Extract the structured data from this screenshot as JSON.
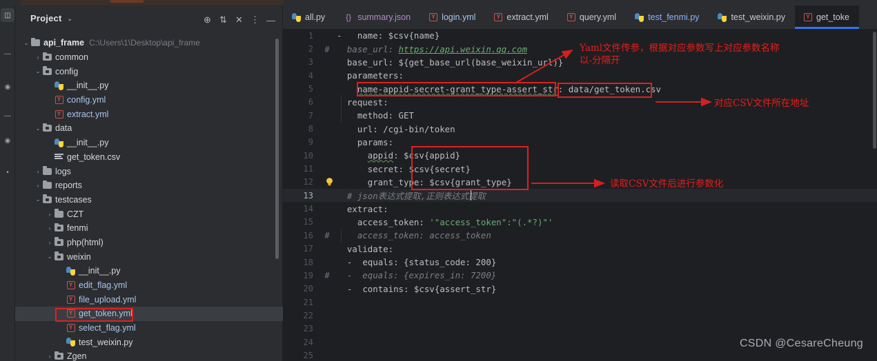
{
  "window": {
    "rail_icons": [
      "project-rail-icon",
      "structure-rail-icon",
      "bookmarks-rail-icon",
      "favorites-rail-icon"
    ]
  },
  "project_panel": {
    "title": "Project",
    "caret": "⌄",
    "tools": [
      {
        "name": "locate-icon",
        "glyph": "⊕"
      },
      {
        "name": "expand-collapse-icon",
        "glyph": "⇅"
      },
      {
        "name": "collapse-all-icon",
        "glyph": "✕"
      },
      {
        "name": "more-options-icon",
        "glyph": "⋮"
      },
      {
        "name": "hide-panel-icon",
        "glyph": "—"
      }
    ],
    "tree": [
      {
        "indent": 0,
        "arrow": "⌄",
        "icon": "folder",
        "label": "api_frame",
        "bold": true,
        "path": "C:\\Users\\1\\Desktop\\api_frame",
        "selected": false
      },
      {
        "indent": 1,
        "arrow": "›",
        "icon": "folder-module",
        "label": "common",
        "bold": false,
        "path": "",
        "selected": false
      },
      {
        "indent": 1,
        "arrow": "⌄",
        "icon": "folder-module",
        "label": "config",
        "bold": false,
        "path": "",
        "selected": false
      },
      {
        "indent": 2,
        "arrow": "",
        "icon": "python",
        "label": "__init__.py",
        "bold": false,
        "path": "",
        "selected": false
      },
      {
        "indent": 2,
        "arrow": "",
        "icon": "yml",
        "label": "config.yml",
        "bold": false,
        "path": "",
        "selected": false,
        "kind": "yml"
      },
      {
        "indent": 2,
        "arrow": "",
        "icon": "yml",
        "label": "extract.yml",
        "bold": false,
        "path": "",
        "selected": false,
        "kind": "yml"
      },
      {
        "indent": 1,
        "arrow": "⌄",
        "icon": "folder-module",
        "label": "data",
        "bold": false,
        "path": "",
        "selected": false
      },
      {
        "indent": 2,
        "arrow": "",
        "icon": "python",
        "label": "__init__.py",
        "bold": false,
        "path": "",
        "selected": false
      },
      {
        "indent": 2,
        "arrow": "",
        "icon": "csv",
        "label": "get_token.csv",
        "bold": false,
        "path": "",
        "selected": false
      },
      {
        "indent": 1,
        "arrow": "›",
        "icon": "folder",
        "label": "logs",
        "bold": false,
        "path": "",
        "selected": false
      },
      {
        "indent": 1,
        "arrow": "›",
        "icon": "folder",
        "label": "reports",
        "bold": false,
        "path": "",
        "selected": false
      },
      {
        "indent": 1,
        "arrow": "⌄",
        "icon": "folder-module",
        "label": "testcases",
        "bold": false,
        "path": "",
        "selected": false
      },
      {
        "indent": 2,
        "arrow": "›",
        "icon": "folder",
        "label": "CZT",
        "bold": false,
        "path": "",
        "selected": false
      },
      {
        "indent": 2,
        "arrow": "›",
        "icon": "folder-module",
        "label": "fenmi",
        "bold": false,
        "path": "",
        "selected": false
      },
      {
        "indent": 2,
        "arrow": "›",
        "icon": "folder-module",
        "label": "php(html)",
        "bold": false,
        "path": "",
        "selected": false
      },
      {
        "indent": 2,
        "arrow": "⌄",
        "icon": "folder-module",
        "label": "weixin",
        "bold": false,
        "path": "",
        "selected": false
      },
      {
        "indent": 3,
        "arrow": "",
        "icon": "python",
        "label": "__init__.py",
        "bold": false,
        "path": "",
        "selected": false
      },
      {
        "indent": 3,
        "arrow": "",
        "icon": "yml",
        "label": "edit_flag.yml",
        "bold": false,
        "path": "",
        "selected": false
      },
      {
        "indent": 3,
        "arrow": "",
        "icon": "yml",
        "label": "file_upload.yml",
        "bold": false,
        "path": "",
        "selected": false
      },
      {
        "indent": 3,
        "arrow": "",
        "icon": "yml",
        "label": "get_token.yml",
        "bold": false,
        "path": "",
        "selected": true
      },
      {
        "indent": 3,
        "arrow": "",
        "icon": "yml",
        "label": "select_flag.yml",
        "bold": false,
        "path": "",
        "selected": false
      },
      {
        "indent": 3,
        "arrow": "",
        "icon": "python",
        "label": "test_weixin.py",
        "bold": false,
        "path": "",
        "selected": false
      },
      {
        "indent": 2,
        "arrow": "›",
        "icon": "folder-module",
        "label": "Zgen",
        "bold": false,
        "path": "",
        "selected": false
      }
    ]
  },
  "editor": {
    "tabs": [
      {
        "label": "all.py",
        "icon": "python",
        "kind": "py",
        "active": false
      },
      {
        "label": "summary.json",
        "icon": "json",
        "kind": "json",
        "active": false
      },
      {
        "label": "login.yml",
        "icon": "yml",
        "kind": "yml",
        "active": false
      },
      {
        "label": "extract.yml",
        "icon": "yml",
        "kind": "ymlw",
        "active": false
      },
      {
        "label": "query.yml",
        "icon": "yml",
        "kind": "ymlw",
        "active": false
      },
      {
        "label": "test_fenmi.py",
        "icon": "python",
        "kind": "pyb",
        "active": false
      },
      {
        "label": "test_weixin.py",
        "icon": "python",
        "kind": "py",
        "active": false
      },
      {
        "label": "get_toke",
        "icon": "yml",
        "kind": "ymlw",
        "active": true
      }
    ],
    "lines": [
      {
        "n": "1",
        "hash": "",
        "bulb": false,
        "current": false,
        "html": "<span class=\"k-dash\">-   </span><span class=\"k-key\">name</span>: $csv{name}"
      },
      {
        "n": "2",
        "hash": "#",
        "bulb": false,
        "current": false,
        "html": "<span class=\"k-com\">  base_url: </span><span class=\"k-url\">https://api.weixin.qq.com</span>"
      },
      {
        "n": "3",
        "hash": "",
        "bulb": false,
        "current": false,
        "html": "  <span class=\"k-key\">base_url</span>: ${get_base_url(base_weixin_url)}"
      },
      {
        "n": "4",
        "hash": "",
        "bulb": false,
        "current": false,
        "html": "  <span class=\"k-key\">parameters</span>:"
      },
      {
        "n": "5",
        "hash": "",
        "bulb": false,
        "current": false,
        "html": "    <span class=\"k-key sq\">name-appid-secret-grant_type-assert_str</span>: data/get_token.csv"
      },
      {
        "n": "6",
        "hash": "",
        "bulb": false,
        "current": false,
        "html": "  <span class=\"k-key\">request</span>:"
      },
      {
        "n": "7",
        "hash": "",
        "bulb": false,
        "current": false,
        "html": "    <span class=\"k-key\">method</span>: GET"
      },
      {
        "n": "8",
        "hash": "",
        "bulb": false,
        "current": false,
        "html": "    <span class=\"k-key\">url</span>: /cgi-bin/token"
      },
      {
        "n": "9",
        "hash": "",
        "bulb": false,
        "current": false,
        "html": "    <span class=\"k-key\">params</span>:"
      },
      {
        "n": "10",
        "hash": "",
        "bulb": false,
        "current": false,
        "html": "      <span class=\"k-key sq\">appid</span>: $csv{appid}"
      },
      {
        "n": "11",
        "hash": "",
        "bulb": false,
        "current": false,
        "html": "      <span class=\"k-key\">secret</span>: $csv{secret}"
      },
      {
        "n": "12",
        "hash": "",
        "bulb": true,
        "current": false,
        "html": "      <span class=\"k-key\">grant_type</span>: $csv{grant_type}"
      },
      {
        "n": "13",
        "hash": "",
        "bulb": false,
        "current": true,
        "html": "<span class=\"k-com\">  # json表达式提取,正则表达式提取</span>"
      },
      {
        "n": "14",
        "hash": "",
        "bulb": false,
        "current": false,
        "html": "  <span class=\"k-key\">extract</span>:"
      },
      {
        "n": "15",
        "hash": "",
        "bulb": false,
        "current": false,
        "html": "    <span class=\"k-key\">access_token</span>: <span class=\"k-str\">'\"access_token\":\"(.*?)\"'</span>"
      },
      {
        "n": "16",
        "hash": "#",
        "bulb": false,
        "current": false,
        "html": "<span class=\"k-com\">    access_token: access_token</span>"
      },
      {
        "n": "17",
        "hash": "",
        "bulb": false,
        "current": false,
        "html": "  <span class=\"k-key\">validate</span>:"
      },
      {
        "n": "18",
        "hash": "",
        "bulb": false,
        "current": false,
        "html": "  <span class=\"k-dash\">-</span>  <span class=\"k-key\">equals</span>: {status_code: 200}"
      },
      {
        "n": "19",
        "hash": "#",
        "bulb": false,
        "current": false,
        "html": "<span class=\"k-com\">  -  equals: {expires_in: 7200}</span>"
      },
      {
        "n": "20",
        "hash": "",
        "bulb": false,
        "current": false,
        "html": "  <span class=\"k-dash\">-</span>  <span class=\"k-key\">contains</span>: $csv{assert_str}"
      },
      {
        "n": "21",
        "hash": "",
        "bulb": false,
        "current": false,
        "html": ""
      },
      {
        "n": "22",
        "hash": "",
        "bulb": false,
        "current": false,
        "html": ""
      },
      {
        "n": "23",
        "hash": "",
        "bulb": false,
        "current": false,
        "html": ""
      },
      {
        "n": "24",
        "hash": "",
        "bulb": false,
        "current": false,
        "html": ""
      },
      {
        "n": "25",
        "hash": "",
        "bulb": false,
        "current": false,
        "html": ""
      }
    ]
  },
  "annotations": [
    {
      "name": "annotation-yaml-params",
      "text": "Yaml文件传参，根据对应参数写上对应参数名称\n以-分隔开"
    },
    {
      "name": "annotation-csv-path",
      "text": "对应CSV文件所在地址"
    },
    {
      "name": "annotation-csv-parameterize",
      "text": "读取CSV文件后进行参数化"
    }
  ],
  "watermark": "CSDN @CesareCheung",
  "colors": {
    "annotation_red": "#c62828",
    "box_red": "#e02020",
    "accent_blue": "#3574f0",
    "editor_bg": "#1e1f22",
    "panel_bg": "#2b2d30"
  }
}
